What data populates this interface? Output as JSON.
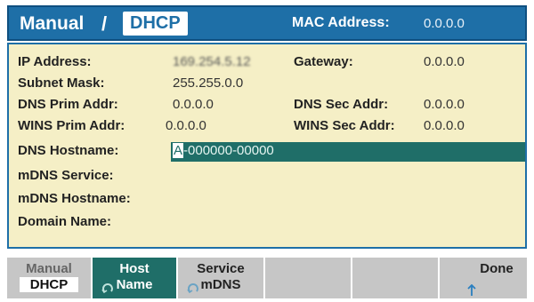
{
  "header": {
    "mode_label": "Manual",
    "separator": "/",
    "selected_mode": "DHCP",
    "mac_label": "MAC Address:",
    "mac_value": "0.0.0.0"
  },
  "fields": {
    "ip_address": {
      "label": "IP Address:",
      "value": "169.254.5.12"
    },
    "gateway": {
      "label": "Gateway:",
      "value": "0.0.0.0"
    },
    "subnet_mask": {
      "label": "Subnet Mask:",
      "value": "255.255.0.0"
    },
    "dns_prim": {
      "label": "DNS Prim Addr:",
      "value": "0.0.0.0"
    },
    "dns_sec": {
      "label": "DNS Sec Addr:",
      "value": "0.0.0.0"
    },
    "wins_prim": {
      "label": "WINS Prim Addr:",
      "value": "0.0.0.0"
    },
    "wins_sec": {
      "label": "WINS Sec Addr:",
      "value": "0.0.0.0"
    },
    "dns_hostname": {
      "label": "DNS Hostname:",
      "cursor_char": "A",
      "value_rest": "-000000-00000"
    },
    "mdns_service": {
      "label": "mDNS Service:",
      "value": ""
    },
    "mdns_hostname": {
      "label": "mDNS Hostname:",
      "value": ""
    },
    "domain_name": {
      "label": "Domain Name:",
      "value": ""
    }
  },
  "softkeys": [
    {
      "line1": "Manual",
      "line2": "DHCP"
    },
    {
      "line1": "Host",
      "line2": "Name"
    },
    {
      "line1": "Service",
      "line2": "mDNS"
    },
    {
      "line1": "",
      "line2": ""
    },
    {
      "line1": "",
      "line2": ""
    },
    {
      "line1": "Done",
      "line2": ""
    }
  ],
  "colors": {
    "header_blue": "#1e6fa7",
    "panel_bg": "#f5efc6",
    "active_key": "#1f6e68",
    "softkey_gray": "#c6c6c6"
  },
  "icons": [
    "knob-icon",
    "up-arrow-icon"
  ]
}
